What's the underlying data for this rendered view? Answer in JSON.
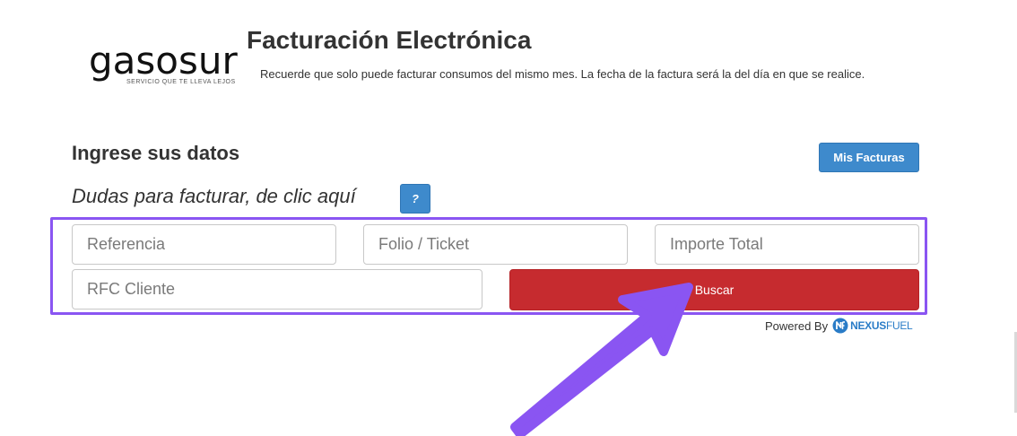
{
  "logo": {
    "word": "gasosur",
    "tagline": "SERVICIO QUE TE LLEVA LEJOS"
  },
  "header": {
    "title": "Facturación Electrónica",
    "notice": "Recuerde que solo puede facturar consumos del mismo mes. La fecha de la factura será la del día en que se realice."
  },
  "section": {
    "title": "Ingrese sus datos",
    "help_text": "Dudas para facturar, de clic aquí",
    "help_button": "?",
    "mis_facturas_button": "Mis Facturas"
  },
  "form": {
    "referencia_placeholder": "Referencia",
    "folio_placeholder": "Folio / Ticket",
    "importe_placeholder": "Importe Total",
    "rfc_placeholder": "RFC Cliente",
    "search_button": "Buscar"
  },
  "footer": {
    "powered_by": "Powered By",
    "brand_prefix": "NEXUS",
    "brand_suffix": "FUEL",
    "brand_icon": "nexusfuel-logo-icon"
  },
  "colors": {
    "primary_blue": "#3e8acc",
    "search_red": "#c62b2f",
    "highlight_purple": "#8a55f2",
    "nexus_blue": "#2a7cc7"
  },
  "annotation": {
    "icon": "arrow-pointer-icon"
  }
}
